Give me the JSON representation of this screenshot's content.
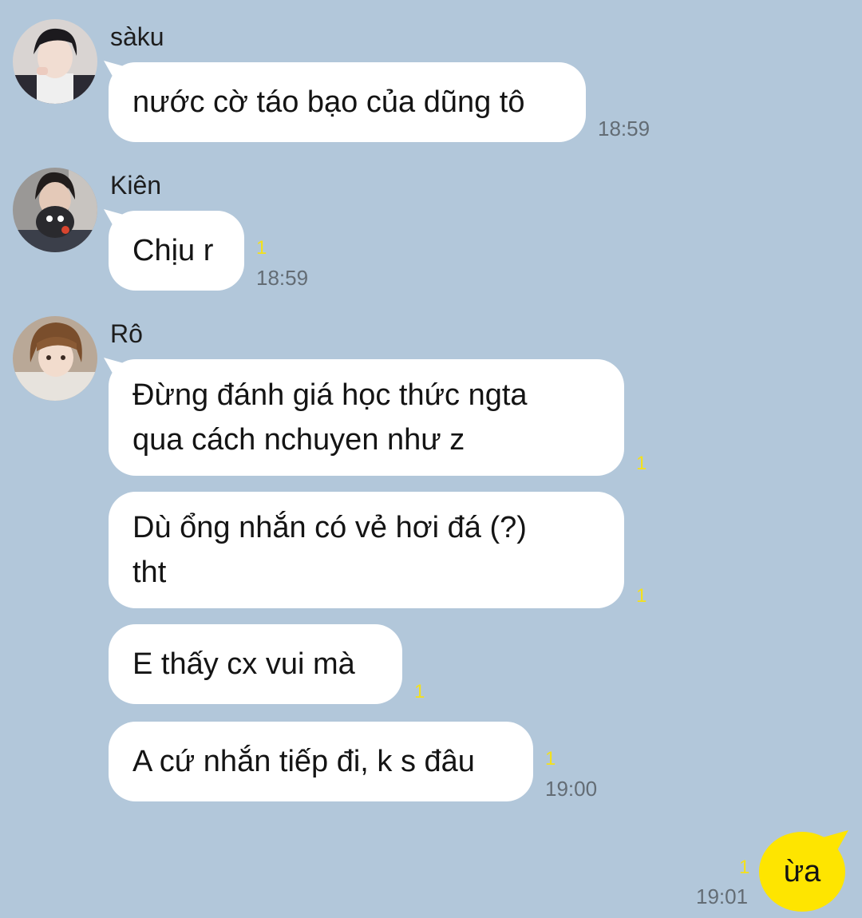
{
  "messages": [
    {
      "sender": "sàku",
      "avatar_icon": "profile-photo-saku",
      "lines": [
        "nước cờ táo bạo của dũng tô"
      ],
      "unread": "",
      "time": "18:59"
    },
    {
      "sender": "Kiên",
      "avatar_icon": "profile-photo-kien",
      "lines": [
        "Chịu r"
      ],
      "unread": "1",
      "time": "18:59"
    },
    {
      "sender": "Rô",
      "avatar_icon": "profile-photo-ro",
      "lines": [
        "Đừng đánh giá học thức ngta",
        "qua cách nchuyen như z"
      ],
      "unread": "1",
      "time": ""
    },
    {
      "sender": "",
      "lines": [
        "Dù ổng nhắn có vẻ hơi đá (?)",
        "tht"
      ],
      "unread": "1",
      "time": ""
    },
    {
      "sender": "",
      "lines": [
        "E thấy cx vui mà"
      ],
      "unread": "1",
      "time": ""
    },
    {
      "sender": "",
      "lines": [
        "A cứ nhắn tiếp đi, k s đâu"
      ],
      "unread": "1",
      "time": "19:00"
    }
  ],
  "my_message": {
    "text": "ừa",
    "unread": "1",
    "time": "19:01"
  },
  "colors": {
    "chat_background": "#b2c7da",
    "incoming_bubble": "#ffffff",
    "outgoing_bubble": "#fee500",
    "unread_count": "#f4e11a",
    "timestamp": "#636c74"
  }
}
